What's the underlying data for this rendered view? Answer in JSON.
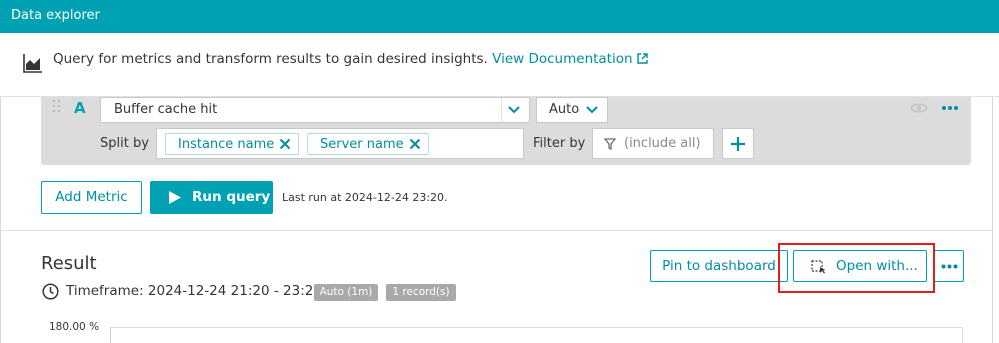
{
  "window": {
    "title": "Data explorer"
  },
  "info": {
    "text": "Query for metrics and transform results to gain desired insights.",
    "link": "View Documentation"
  },
  "query": {
    "letter": "A",
    "metric": "Buffer cache hit",
    "aggregation": "Auto",
    "split_by_label": "Split by",
    "split_by": [
      "Instance name",
      "Server name"
    ],
    "filter_by_label": "Filter by",
    "filter_placeholder": "(include all)"
  },
  "actions": {
    "add_metric": "Add Metric",
    "run_query": "Run query",
    "last_run": "Last run at 2024-12-24 23:20."
  },
  "result": {
    "title": "Result",
    "timeframe": "Timeframe: 2024-12-24 21:20 - 23:20",
    "badges": [
      "Auto (1m)",
      "1 record(s)"
    ],
    "pin_to_dashboard": "Pin to dashboard",
    "open_with": "Open with...",
    "y_top_label": "180.00 %"
  },
  "colors": {
    "brand": "#00a1b2",
    "link": "#008ea1",
    "highlight": "#e01f1f",
    "panel": "#dcdcdc"
  }
}
